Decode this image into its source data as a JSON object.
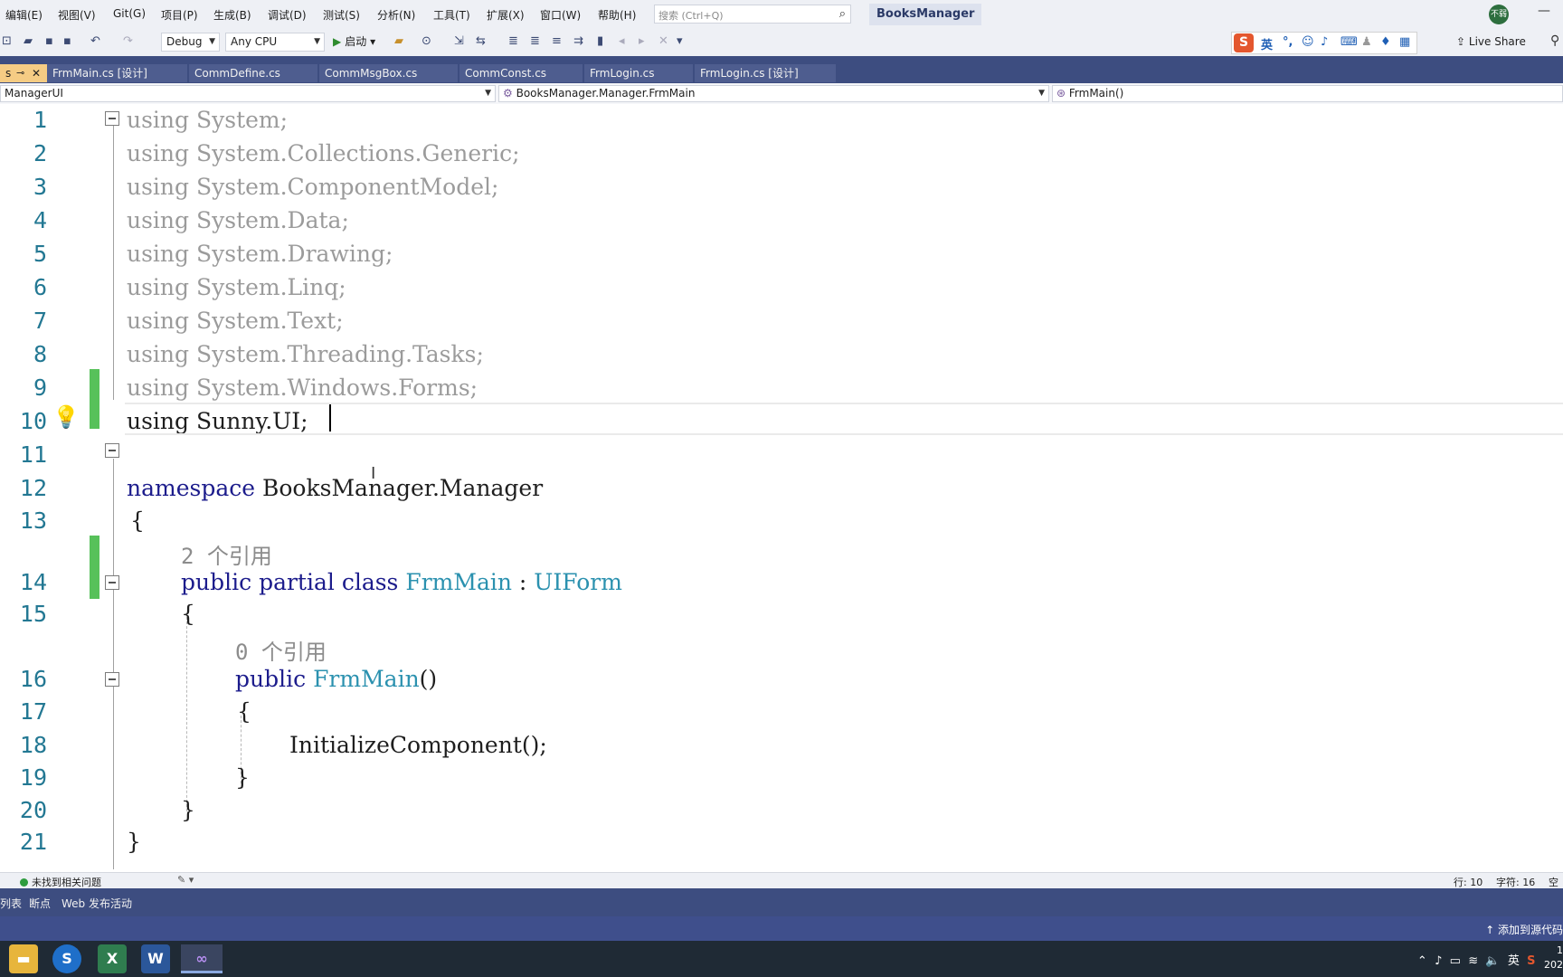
{
  "menu": {
    "items": [
      "编辑(E)",
      "视图(V)",
      "Git(G)",
      "项目(P)",
      "生成(B)",
      "调试(D)",
      "测试(S)",
      "分析(N)",
      "工具(T)",
      "扩展(X)",
      "窗口(W)",
      "帮助(H)"
    ],
    "search_placeholder": "搜索 (Ctrl+Q)",
    "app_title": "BooksManager",
    "avatar_text": "不弱"
  },
  "toolbar": {
    "config": "Debug",
    "platform": "Any CPU",
    "start_label": "启动",
    "live_share": "Live Share",
    "ime_lang": "英"
  },
  "tabs": {
    "active_label": "s",
    "items": [
      "FrmMain.cs [设计]",
      "CommDefine.cs",
      "CommMsgBox.cs",
      "CommConst.cs",
      "FrmLogin.cs",
      "FrmLogin.cs [设计]"
    ]
  },
  "nav": {
    "project": "ManagerUI",
    "type": "BooksManager.Manager.FrmMain",
    "member": "FrmMain()"
  },
  "code": {
    "line_numbers": [
      "1",
      "2",
      "3",
      "4",
      "5",
      "6",
      "7",
      "8",
      "9",
      "10",
      "11",
      "12",
      "13",
      "14",
      "15",
      "16",
      "17",
      "18",
      "19",
      "20",
      "21"
    ],
    "usings": [
      "System;",
      "System.Collections.Generic;",
      "System.ComponentModel;",
      "System.Data;",
      "System.Drawing;",
      "System.Linq;",
      "System.Text;",
      "System.Threading.Tasks;",
      "System.Windows.Forms;"
    ],
    "kw_using": "using",
    "using_sunny": "Sunny.UI;",
    "kw_namespace": "namespace",
    "namespace_name": "BooksManager.Manager",
    "open_brace": "{",
    "close_brace": "}",
    "lens_class": "2 个引用",
    "kw_public": "public",
    "kw_partial": "partial",
    "kw_class": "class",
    "class_name": "FrmMain",
    "colon": ":",
    "base_class": "UIForm",
    "lens_ctor": "0 个引用",
    "ctor_name": "FrmMain",
    "ctor_parens": "()",
    "call": "InitializeComponent();"
  },
  "status": {
    "issues": "未找到相关问题",
    "line": "行: 10",
    "char": "字符: 16",
    "extra": "空格"
  },
  "panels": [
    "列表",
    "断点",
    "Web 发布活动"
  ],
  "source_control": "添加到源代码",
  "tray": {
    "ime": "英",
    "time": "1",
    "date": "202"
  }
}
